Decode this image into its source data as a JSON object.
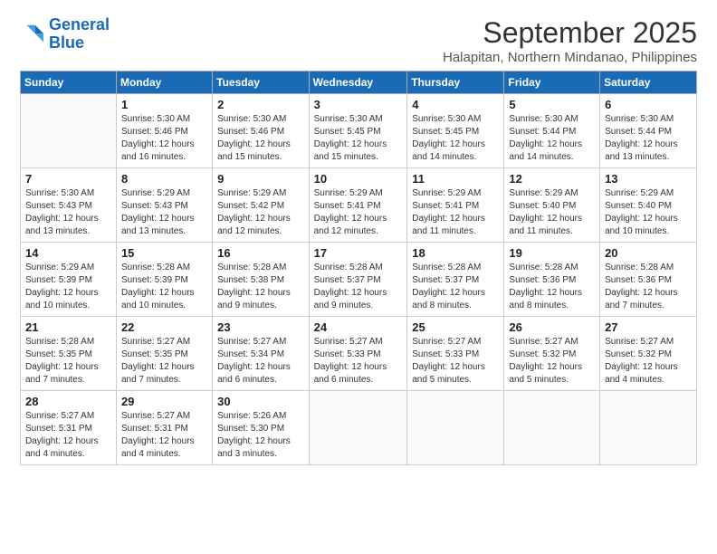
{
  "logo": {
    "line1": "General",
    "line2": "Blue"
  },
  "title": "September 2025",
  "subtitle": "Halapitan, Northern Mindanao, Philippines",
  "days_of_week": [
    "Sunday",
    "Monday",
    "Tuesday",
    "Wednesday",
    "Thursday",
    "Friday",
    "Saturday"
  ],
  "weeks": [
    [
      {
        "num": "",
        "info": ""
      },
      {
        "num": "1",
        "info": "Sunrise: 5:30 AM\nSunset: 5:46 PM\nDaylight: 12 hours\nand 16 minutes."
      },
      {
        "num": "2",
        "info": "Sunrise: 5:30 AM\nSunset: 5:46 PM\nDaylight: 12 hours\nand 15 minutes."
      },
      {
        "num": "3",
        "info": "Sunrise: 5:30 AM\nSunset: 5:45 PM\nDaylight: 12 hours\nand 15 minutes."
      },
      {
        "num": "4",
        "info": "Sunrise: 5:30 AM\nSunset: 5:45 PM\nDaylight: 12 hours\nand 14 minutes."
      },
      {
        "num": "5",
        "info": "Sunrise: 5:30 AM\nSunset: 5:44 PM\nDaylight: 12 hours\nand 14 minutes."
      },
      {
        "num": "6",
        "info": "Sunrise: 5:30 AM\nSunset: 5:44 PM\nDaylight: 12 hours\nand 13 minutes."
      }
    ],
    [
      {
        "num": "7",
        "info": "Sunrise: 5:30 AM\nSunset: 5:43 PM\nDaylight: 12 hours\nand 13 minutes."
      },
      {
        "num": "8",
        "info": "Sunrise: 5:29 AM\nSunset: 5:43 PM\nDaylight: 12 hours\nand 13 minutes."
      },
      {
        "num": "9",
        "info": "Sunrise: 5:29 AM\nSunset: 5:42 PM\nDaylight: 12 hours\nand 12 minutes."
      },
      {
        "num": "10",
        "info": "Sunrise: 5:29 AM\nSunset: 5:41 PM\nDaylight: 12 hours\nand 12 minutes."
      },
      {
        "num": "11",
        "info": "Sunrise: 5:29 AM\nSunset: 5:41 PM\nDaylight: 12 hours\nand 11 minutes."
      },
      {
        "num": "12",
        "info": "Sunrise: 5:29 AM\nSunset: 5:40 PM\nDaylight: 12 hours\nand 11 minutes."
      },
      {
        "num": "13",
        "info": "Sunrise: 5:29 AM\nSunset: 5:40 PM\nDaylight: 12 hours\nand 10 minutes."
      }
    ],
    [
      {
        "num": "14",
        "info": "Sunrise: 5:29 AM\nSunset: 5:39 PM\nDaylight: 12 hours\nand 10 minutes."
      },
      {
        "num": "15",
        "info": "Sunrise: 5:28 AM\nSunset: 5:39 PM\nDaylight: 12 hours\nand 10 minutes."
      },
      {
        "num": "16",
        "info": "Sunrise: 5:28 AM\nSunset: 5:38 PM\nDaylight: 12 hours\nand 9 minutes."
      },
      {
        "num": "17",
        "info": "Sunrise: 5:28 AM\nSunset: 5:37 PM\nDaylight: 12 hours\nand 9 minutes."
      },
      {
        "num": "18",
        "info": "Sunrise: 5:28 AM\nSunset: 5:37 PM\nDaylight: 12 hours\nand 8 minutes."
      },
      {
        "num": "19",
        "info": "Sunrise: 5:28 AM\nSunset: 5:36 PM\nDaylight: 12 hours\nand 8 minutes."
      },
      {
        "num": "20",
        "info": "Sunrise: 5:28 AM\nSunset: 5:36 PM\nDaylight: 12 hours\nand 7 minutes."
      }
    ],
    [
      {
        "num": "21",
        "info": "Sunrise: 5:28 AM\nSunset: 5:35 PM\nDaylight: 12 hours\nand 7 minutes."
      },
      {
        "num": "22",
        "info": "Sunrise: 5:27 AM\nSunset: 5:35 PM\nDaylight: 12 hours\nand 7 minutes."
      },
      {
        "num": "23",
        "info": "Sunrise: 5:27 AM\nSunset: 5:34 PM\nDaylight: 12 hours\nand 6 minutes."
      },
      {
        "num": "24",
        "info": "Sunrise: 5:27 AM\nSunset: 5:33 PM\nDaylight: 12 hours\nand 6 minutes."
      },
      {
        "num": "25",
        "info": "Sunrise: 5:27 AM\nSunset: 5:33 PM\nDaylight: 12 hours\nand 5 minutes."
      },
      {
        "num": "26",
        "info": "Sunrise: 5:27 AM\nSunset: 5:32 PM\nDaylight: 12 hours\nand 5 minutes."
      },
      {
        "num": "27",
        "info": "Sunrise: 5:27 AM\nSunset: 5:32 PM\nDaylight: 12 hours\nand 4 minutes."
      }
    ],
    [
      {
        "num": "28",
        "info": "Sunrise: 5:27 AM\nSunset: 5:31 PM\nDaylight: 12 hours\nand 4 minutes."
      },
      {
        "num": "29",
        "info": "Sunrise: 5:27 AM\nSunset: 5:31 PM\nDaylight: 12 hours\nand 4 minutes."
      },
      {
        "num": "30",
        "info": "Sunrise: 5:26 AM\nSunset: 5:30 PM\nDaylight: 12 hours\nand 3 minutes."
      },
      {
        "num": "",
        "info": ""
      },
      {
        "num": "",
        "info": ""
      },
      {
        "num": "",
        "info": ""
      },
      {
        "num": "",
        "info": ""
      }
    ]
  ]
}
